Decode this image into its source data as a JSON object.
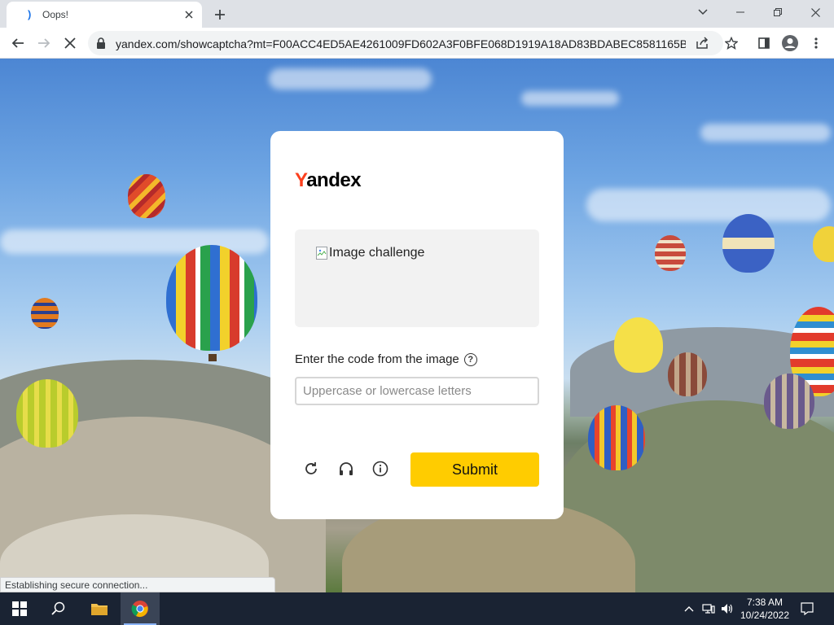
{
  "browser": {
    "tab": {
      "title": "Oops!",
      "favicon": "yandex-favicon"
    },
    "url": "yandex.com/showcaptcha?mt=F00ACC4ED5AE4261009FD602A3F0BFE068D1919A18AD83BDABEC8581165BCC4...",
    "status_text": "Establishing secure connection..."
  },
  "captcha": {
    "logo_y": "Y",
    "logo_rest": "andex",
    "image_alt": "Image challenge",
    "prompt": "Enter the code from the image",
    "help_glyph": "?",
    "input_placeholder": "Uppercase or lowercase letters",
    "input_value": "",
    "submit_label": "Submit"
  },
  "taskbar": {
    "time": "7:38 AM",
    "date": "10/24/2022"
  },
  "colors": {
    "yandex_red": "#fc3f1d",
    "submit_yellow": "#ffcc00",
    "taskbar": "#1a2333"
  }
}
